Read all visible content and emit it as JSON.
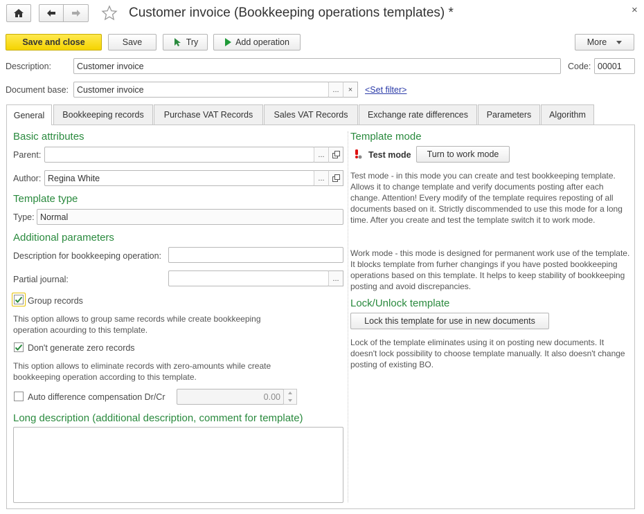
{
  "window": {
    "title": "Customer invoice (Bookkeeping operations templates) *",
    "close_glyph": "×"
  },
  "toolbar": {
    "save_close_label": "Save and close",
    "save_label": "Save",
    "try_label": "Try",
    "add_operation_label": "Add operation",
    "more_label": "More"
  },
  "header": {
    "description_label": "Description:",
    "description_value": "Customer invoice",
    "code_label": "Code:",
    "code_value": "00001",
    "document_base_label": "Document base:",
    "document_base_value": "Customer invoice",
    "set_filter_label": "<Set filter>"
  },
  "tabs": [
    {
      "label": "General",
      "active": true
    },
    {
      "label": "Bookkeeping records",
      "active": false
    },
    {
      "label": "Purchase VAT Records",
      "active": false
    },
    {
      "label": "Sales VAT Records",
      "active": false
    },
    {
      "label": "Exchange rate differences",
      "active": false
    },
    {
      "label": "Parameters",
      "active": false
    },
    {
      "label": "Algorithm",
      "active": false
    }
  ],
  "general": {
    "basic_attributes_title": "Basic attributes",
    "parent_label": "Parent:",
    "parent_value": "",
    "author_label": "Author:",
    "author_value": "Regina White",
    "template_type_title": "Template type",
    "type_label": "Type:",
    "type_value": "Normal",
    "additional_params_title": "Additional parameters",
    "desc_for_op_label": "Description for bookkeeping operation:",
    "desc_for_op_value": "",
    "partial_journal_label": "Partial journal:",
    "partial_journal_value": "",
    "group_records_label": "Group records",
    "group_records_checked": true,
    "group_records_note": "This option allows to group same records while create bookkeeping operation acourding to this template.",
    "no_zero_label": "Don't generate zero records",
    "no_zero_checked": true,
    "no_zero_note": "This option allows to eliminate records with zero-amounts while create bookkeeping operation according to this template.",
    "auto_diff_label": "Auto difference compensation Dr/Cr",
    "auto_diff_checked": false,
    "auto_diff_value": "0.00",
    "long_desc_title": "Long description (additional description, comment for template)",
    "long_desc_value": ""
  },
  "template_mode": {
    "title": "Template mode",
    "status_label": "Test mode",
    "switch_button_label": "Turn to work mode",
    "test_mode_note": "Test mode - in this mode you can create and test bookkeeping template. Allows it to change template and verify documents posting after each change. Attention! Every modify of the template requires reposting of all documents based on it. Strictly discommended to use this mode for a long time. After you create and test the template switch it to work mode.",
    "work_mode_note": "Work mode - this mode is designed for permanent work use of the template. It blocks template from furher changings if you have posted bookkeeping operations based on this template. It helps to keep stability of bookkeeping posting and avoid discrepancies.",
    "lock_title": "Lock/Unlock template",
    "lock_button_label": "Lock this template for use in new documents",
    "lock_note": "Lock of the template eliminates using it on posting new documents. It doesn't lock possibility to choose template manually. It also doesn't change posting of existing BO."
  },
  "colors": {
    "accent_green": "#2a8a3e",
    "primary_yellow": "#f5d400",
    "link_blue": "#2a3aa8"
  }
}
